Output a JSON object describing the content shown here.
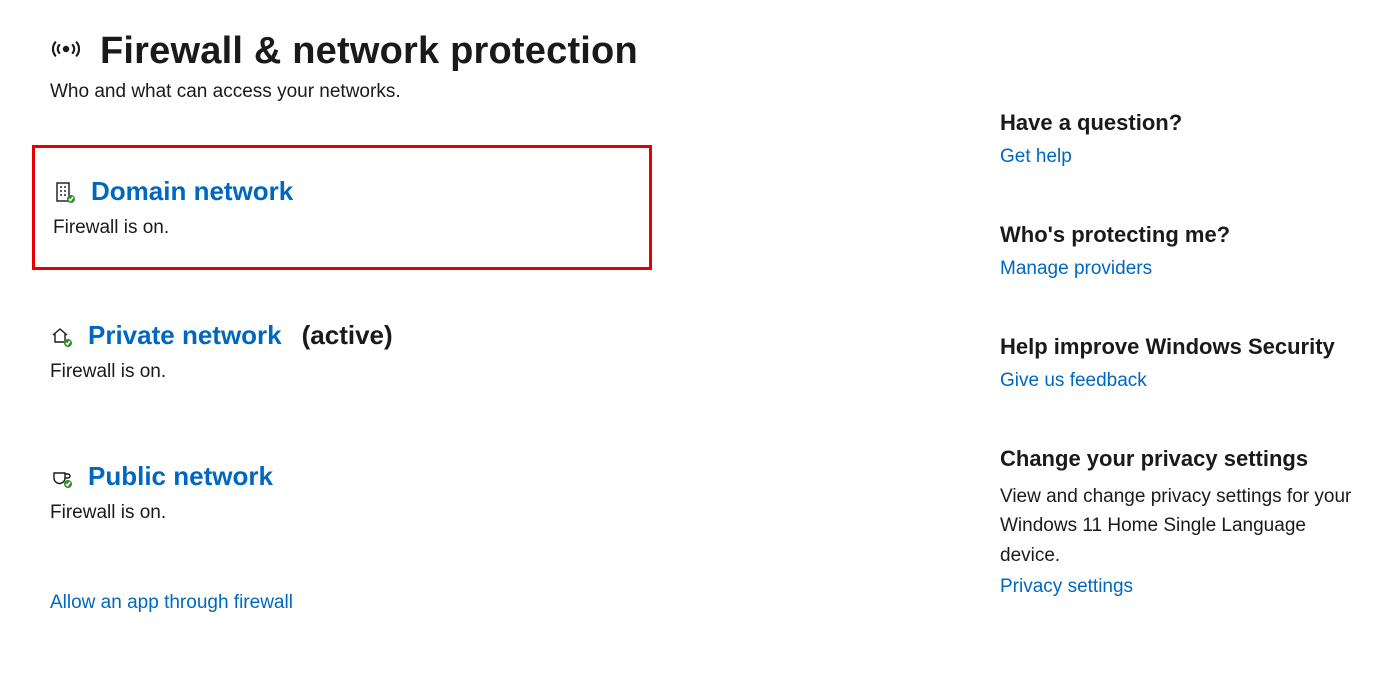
{
  "header": {
    "title": "Firewall & network protection",
    "subtitle": "Who and what can access your networks."
  },
  "networks": {
    "domain": {
      "title": "Domain network",
      "status": "Firewall is on."
    },
    "private": {
      "title": "Private network",
      "active_label": "(active)",
      "status": "Firewall is on."
    },
    "public": {
      "title": "Public network",
      "status": "Firewall is on."
    }
  },
  "bottom_link": "Allow an app through firewall",
  "sidebar": {
    "question": {
      "heading": "Have a question?",
      "link": "Get help"
    },
    "protecting": {
      "heading": "Who's protecting me?",
      "link": "Manage providers"
    },
    "improve": {
      "heading": "Help improve Windows Security",
      "link": "Give us feedback"
    },
    "privacy": {
      "heading": "Change your privacy settings",
      "desc": "View and change privacy settings for your Windows 11 Home Single Language device.",
      "link": "Privacy settings"
    }
  }
}
